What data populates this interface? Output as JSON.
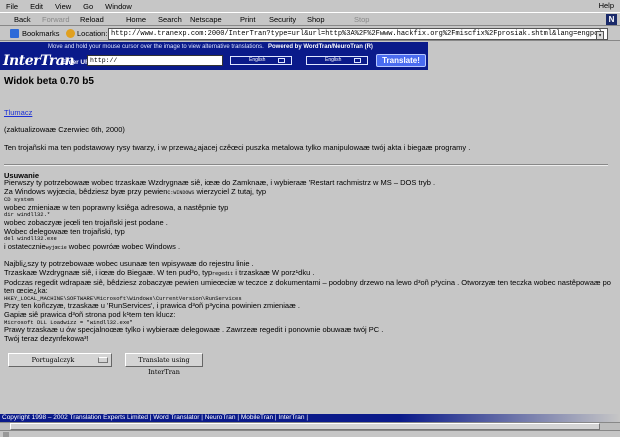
{
  "menubar": {
    "items": [
      "File",
      "Edit",
      "View",
      "Go",
      "Window"
    ],
    "help": "Help"
  },
  "navbar": {
    "back": "Back",
    "forward": "Forward",
    "reload": "Reload",
    "home": "Home",
    "search": "Search",
    "netscape": "Netscape",
    "print": "Print",
    "security": "Security",
    "shop": "Shop",
    "stop": "Stop",
    "logo": "N"
  },
  "locbar": {
    "bookmarks": "Bookmarks",
    "location": "Location:",
    "url": "http://www.tranexp.com:2000/InterTran?type=url&url=http%3A%2F%2Fwww.hackfix.org%2Fmiscfix%2Fprosiak.shtml&lang=engpol"
  },
  "banner": {
    "tip": "Move and hold your mouse cursor over the image to view alternative translations.",
    "powered": "Powered by WordTran/NeuroTran (R)",
    "logo": "InterTran",
    "enter_url": "Enter URL",
    "url_value": "http://",
    "lang_from": "English",
    "lang_to": "English",
    "translate": "Translate!"
  },
  "page": {
    "title": "Widok beta 0.70 b5",
    "link": "Tlumacz",
    "updated": "(zaktualizowaæ Czerwiec 6th, 2000)",
    "intro": "Ten trojañski ma ten podstawowy rysy twarzy, i w przewa¿ajacej czêœci puszka metalowa tylko manipulowaæ twój akta i biegaæ programy .",
    "section": "Usuwanie",
    "lines": [
      {
        "t": "Pierwszy ty potrzebowaæ wobec trzaskaæ Wzdrygnaæ siê, iœæ do Zamknaæ, i wybieraæ 'Restart rachmistrz w MS – DOS tryb .",
        "c": "n"
      },
      {
        "t": "Za Windows wyjœcia, bêdziesz byæ przy pewien",
        "s": "C:WINDOWS",
        "e": " wierzyciel Z tutaj, typ",
        "c": "mix"
      },
      {
        "t": "CD system",
        "c": "mono"
      },
      {
        "t": "wobec zmieniaæ w ten poprawny ksiêga adresowa, a nastêpnie typ",
        "c": "n"
      },
      {
        "t": "dir windll32.*",
        "c": "mono"
      },
      {
        "t": "wobec zobaczyæ jeœli ten trojañski jest podane .",
        "c": "n"
      },
      {
        "t": "Wobec delegowaæ ten trojañski, typ",
        "c": "n"
      },
      {
        "t": "del windll32.exe",
        "c": "mono"
      },
      {
        "t": "i ostatecznie",
        "s": "wyjœcie",
        "e": " wobec powróæ wobec Windows .",
        "c": "mix"
      },
      {
        "t": "",
        "c": "gap"
      },
      {
        "t": "Najbli¿szy ty potrzebowaæ wobec usunaæ ten wpisywaæ do rejestru linie .",
        "c": "n"
      },
      {
        "t": "Trzaskaæ Wzdrygnaæ siê, i iœæ do Biegaæ. W ten pud³o, typ",
        "s": "regedit",
        "e": " i trzaskaæ W porz¹dku .",
        "c": "mix"
      },
      {
        "t": "Podczas regedit wdrapaæ siê, bêdziesz zobaczyæ pewien umieœciæ w teczce z dokumentami – podobny drzewo na lewo d³oñ p³ycina . Otworzyæ ten teczka wobec nastêpowaæ po ten œcie¿ka:",
        "c": "n"
      },
      {
        "t": "HKEY_LOCAL_MACHINE\\SOFTWARE\\Microsoft\\Windows\\CurrentVersion\\RunServices",
        "c": "mono"
      },
      {
        "t": "Przy ten koñczyæ, trzaskaæ u 'RunServices', i prawica d³oñ p³ycina powinien zmieniaæ .",
        "c": "n"
      },
      {
        "t": "Gapiæ siê prawica d³oñ strona pod k¹tem ten klucz:",
        "c": "n"
      },
      {
        "t": "Microsoft DLL Loadwizz = \"windll32.exe\"",
        "c": "mono"
      },
      {
        "t": "Prawy trzaskaæ u ów specjalnoœæ tylko i wybieraæ delegowaæ . Zawrzeæ regedit i ponownie obuwaæ twój PC .",
        "c": "n"
      },
      {
        "t": "Twój teraz dezynfekowa³!",
        "c": "n"
      }
    ],
    "lang_select": "Portugalczyk",
    "translate_button": "Translate using InterTran"
  },
  "footer": "Copyright 1998 – 2002 Translation Experts Limited | Word Translator | NeuroTran | MobileTran | InterTran |"
}
